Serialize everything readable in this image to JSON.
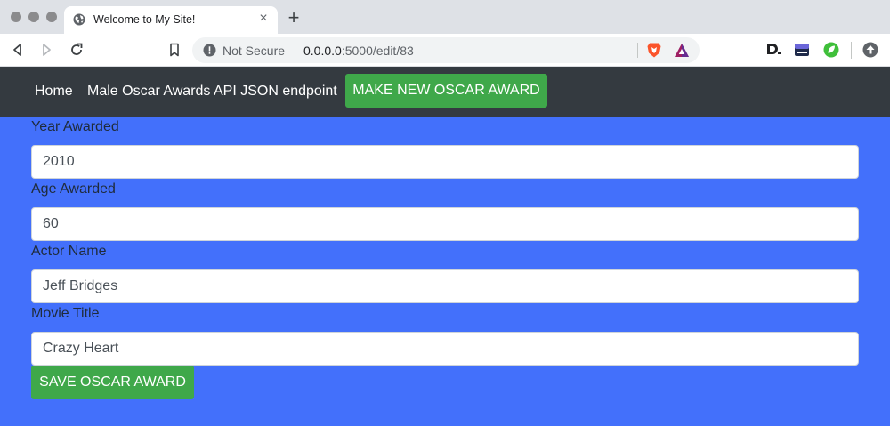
{
  "browser": {
    "tab_title": "Welcome to My Site!",
    "security_label": "Not Secure",
    "url_host": "0.0.0.0",
    "url_rest": ":5000/edit/83",
    "icons": [
      "globe-icon",
      "close-icon",
      "plus-icon",
      "back-icon",
      "forward-icon",
      "reload-icon",
      "bookmark-icon",
      "info-icon",
      "brave-shield-icon",
      "brave-rewards-icon",
      "d-extension-icon",
      "bar-extension-icon",
      "leaf-extension-icon",
      "update-icon"
    ]
  },
  "nav": {
    "home": "Home",
    "api_link": "Male Oscar Awards API JSON endpoint",
    "new_button": "MAKE NEW OSCAR AWARD",
    "background": "#343a40"
  },
  "form": {
    "background": "#4370fb",
    "fields": [
      {
        "label": "Year Awarded",
        "value": "2010"
      },
      {
        "label": "Age Awarded",
        "value": "60"
      },
      {
        "label": "Actor Name",
        "value": "Jeff Bridges"
      },
      {
        "label": "Movie Title",
        "value": "Crazy Heart"
      }
    ],
    "submit": "SAVE OSCAR AWARD",
    "button_color": "#3fa84a"
  }
}
